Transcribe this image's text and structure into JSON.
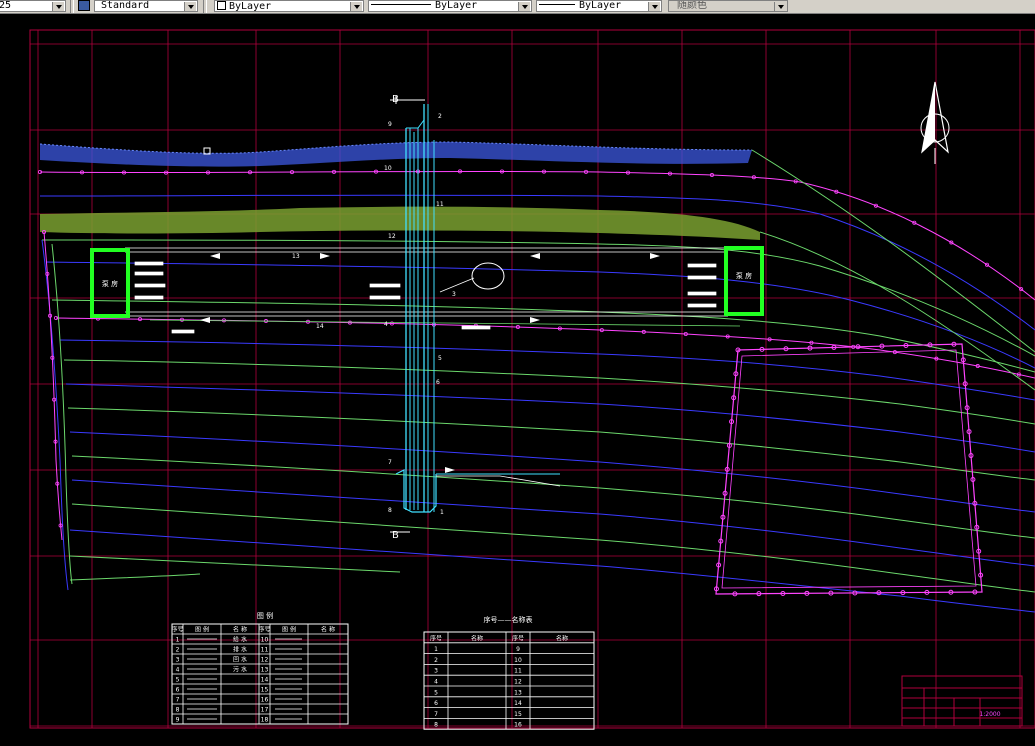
{
  "toolbar": {
    "item0_value": "25",
    "text_style_value": "Standard",
    "layer_color_value": "ByLayer",
    "linetype_value": "ByLayer",
    "lineweight_value": "ByLayer",
    "plot_style_value": "随颜色"
  },
  "drawing": {
    "section_label_top": "B",
    "section_label_bottom": "B",
    "pump_station_label_left": "泵 房",
    "pump_station_label_right": "泵 房",
    "pipe_numbers": [
      "2",
      "9",
      "10",
      "11",
      "12",
      "13",
      "14",
      "4",
      "5",
      "6",
      "7",
      "8",
      "1",
      "3"
    ]
  },
  "legend_table": {
    "title": "图 例",
    "headers": [
      "序号",
      "图 例",
      "名 称",
      "序号",
      "图 例",
      "名 称"
    ],
    "rows": [
      [
        "1",
        "",
        "给 水",
        "10",
        "",
        ""
      ],
      [
        "2",
        "",
        "排 水",
        "11",
        "",
        ""
      ],
      [
        "3",
        "",
        "回 水",
        "12",
        "",
        ""
      ],
      [
        "4",
        "",
        "污 水",
        "13",
        "",
        ""
      ],
      [
        "5",
        "",
        "",
        "14",
        "",
        ""
      ],
      [
        "6",
        "",
        "",
        "15",
        "",
        ""
      ],
      [
        "7",
        "",
        "",
        "16",
        "",
        ""
      ],
      [
        "8",
        "",
        "",
        "17",
        "",
        ""
      ],
      [
        "9",
        "",
        "",
        "18",
        "",
        ""
      ]
    ]
  },
  "device_table": {
    "title": "序号——名称表",
    "headers": [
      "序号",
      "名称",
      "序号",
      "名称"
    ],
    "rows": [
      [
        "1",
        "",
        "9",
        ""
      ],
      [
        "2",
        "",
        "10",
        ""
      ],
      [
        "3",
        "",
        "11",
        ""
      ],
      [
        "4",
        "",
        "12",
        ""
      ],
      [
        "5",
        "",
        "13",
        ""
      ],
      [
        "6",
        "",
        "14",
        ""
      ],
      [
        "7",
        "",
        "15",
        ""
      ],
      [
        "8",
        "",
        "16",
        ""
      ]
    ]
  },
  "title_block": {
    "project": "",
    "drawing_name": "",
    "scale": "1:2000"
  },
  "colors": {
    "background": "#000000",
    "grid": "#b0003c",
    "contour_green": "#6cd86c",
    "contour_blue": "#3a3aff",
    "contour_magenta": "#ff44ff",
    "pipe_cyan": "#40e0ff",
    "pump_green": "#22ff22",
    "hatch_green": "#9ad040",
    "hatch_blue": "#3c58e0",
    "table_white": "#ffffff"
  }
}
